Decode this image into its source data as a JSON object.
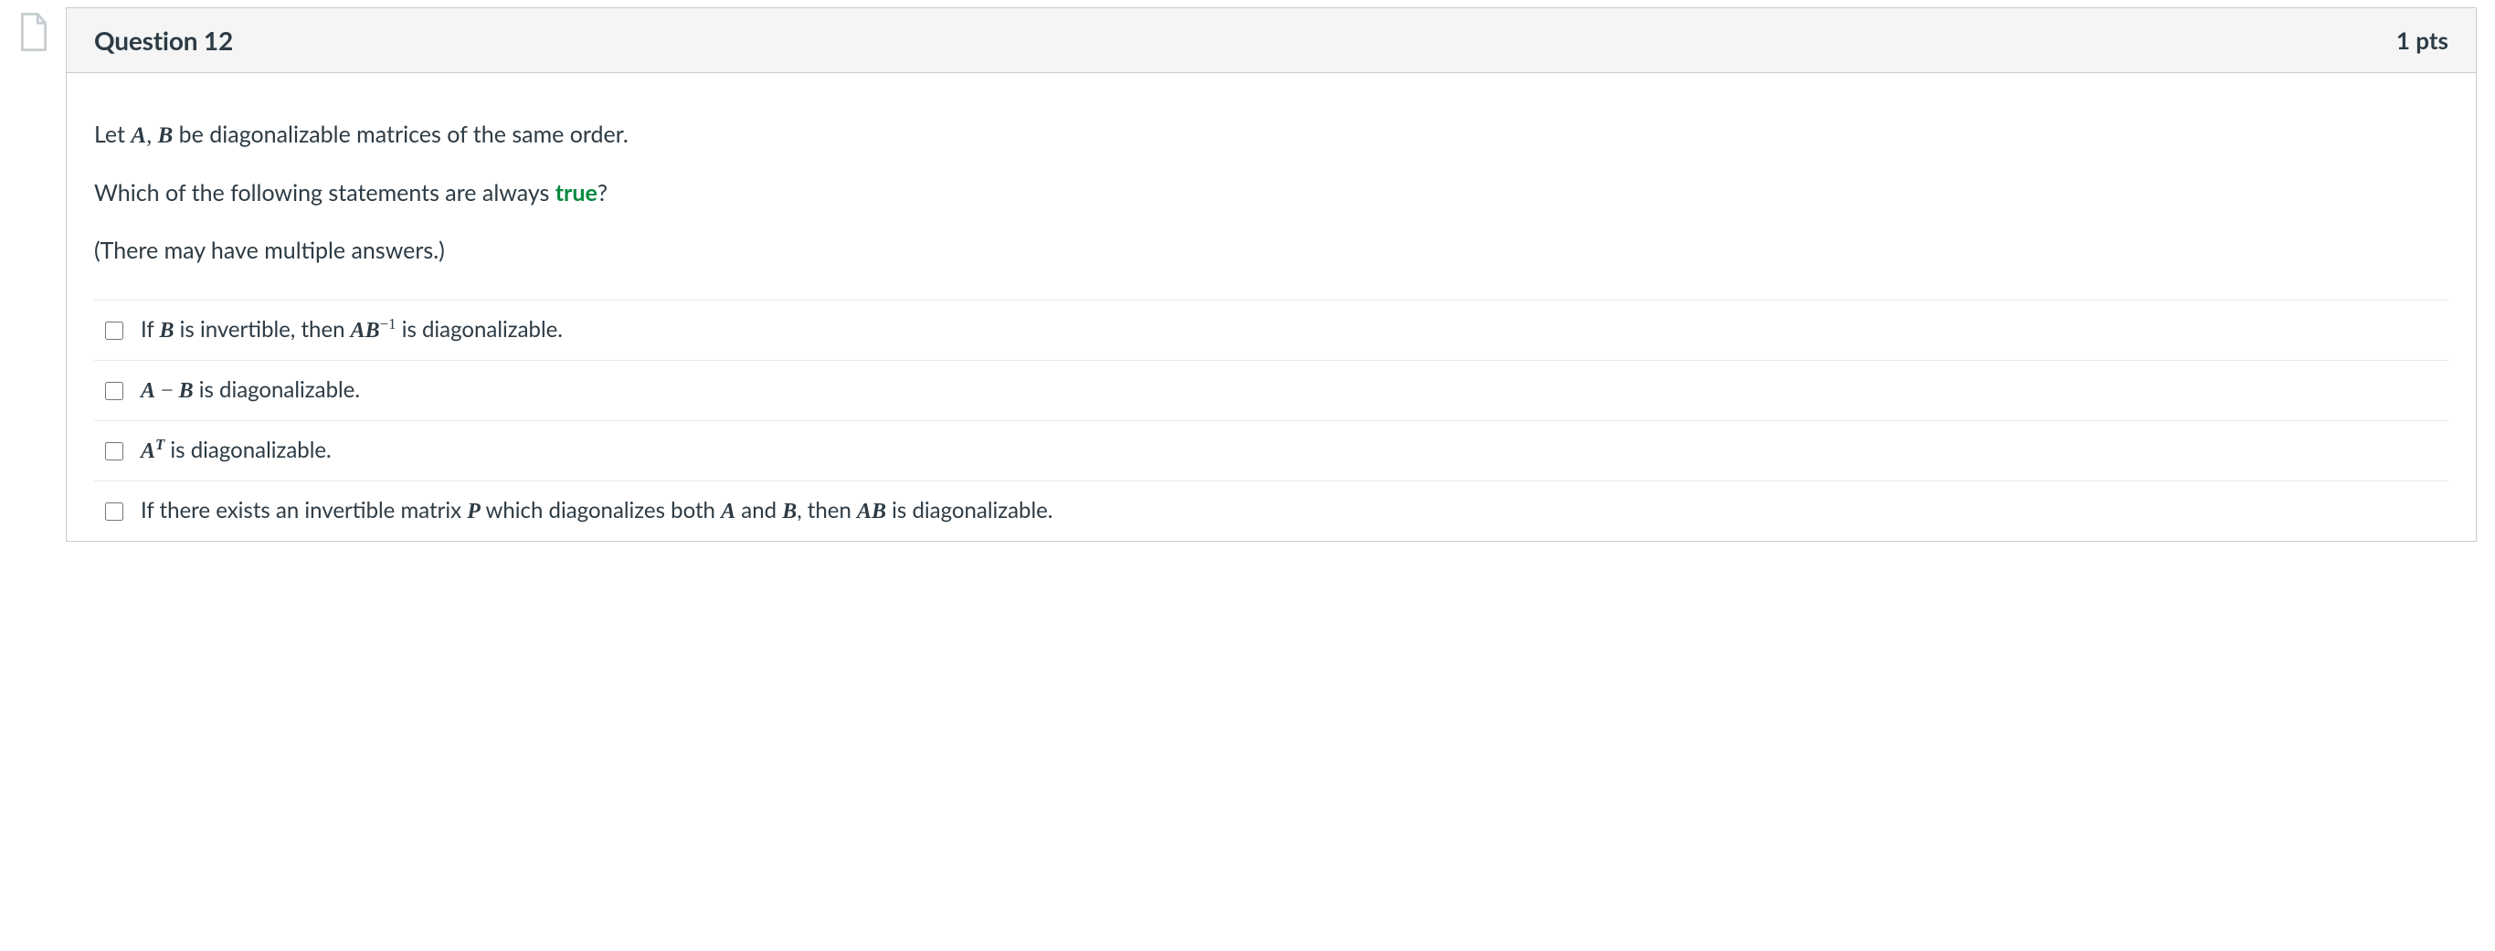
{
  "question": {
    "title": "Question 12",
    "points": "1 pts",
    "prompt_line1_pre": "Let  ",
    "A": "A",
    "comma": ", ",
    "B": "B",
    "prompt_line1_post": "  be diagonalizable matrices of the same order.",
    "prompt_line2_pre": "Which of the following statements are always ",
    "prompt_line2_true": "true",
    "prompt_line2_post": "?",
    "prompt_line3": "(There may have multiple answers.)"
  },
  "answers": [
    {
      "parts": {
        "p0": "If  ",
        "p1": "B",
        "p2": "  is invertible, then  ",
        "p3a": "A",
        "p3b": "B",
        "p4sup": "−1",
        "p5": "  is diagonalizable."
      }
    },
    {
      "parts": {
        "p0": "",
        "p1a": "A",
        "p1s": " − ",
        "p1b": "B",
        "p2": "  is diagonalizable."
      }
    },
    {
      "parts": {
        "p0": "",
        "p1": "A",
        "p1sup": "T",
        "p2": "  is diagonalizable."
      }
    },
    {
      "parts": {
        "p0": "If there exists an invertible matrix  ",
        "p1": "P",
        "p2": "  which diagonalizes both  ",
        "p3": "A",
        "p4": "  and  ",
        "p5": "B",
        "p6": ",  then  ",
        "p7a": "A",
        "p7b": "B",
        "p8": "  is diagonalizable."
      }
    }
  ]
}
